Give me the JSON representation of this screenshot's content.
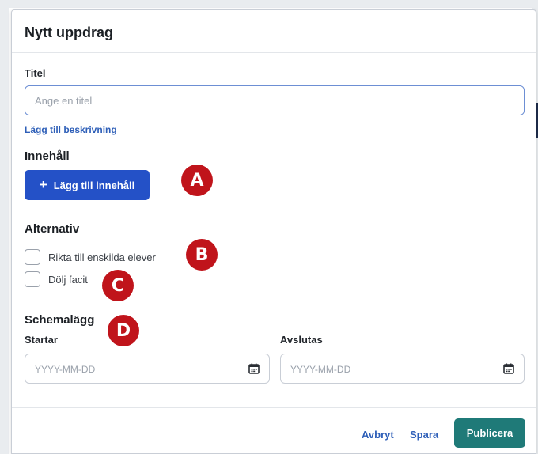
{
  "dialog": {
    "title": "Nytt uppdrag"
  },
  "form": {
    "title_label": "Titel",
    "title_placeholder": "Ange en titel",
    "add_description_link": "Lägg till beskrivning",
    "content_heading": "Innehåll",
    "add_content_button": "Lägg till innehåll",
    "options_heading": "Alternativ",
    "options": [
      {
        "label": "Rikta till enskilda elever",
        "checked": false
      },
      {
        "label": "Dölj facit",
        "checked": false
      }
    ],
    "schedule_heading": "Schemalägg",
    "start_label": "Startar",
    "start_placeholder": "YYYY-MM-DD",
    "end_label": "Avslutas",
    "end_placeholder": "YYYY-MM-DD"
  },
  "footer": {
    "cancel_label": "Avbryt",
    "save_label": "Spara",
    "publish_label": "Publicera"
  },
  "markers": [
    "A",
    "B",
    "C",
    "D"
  ],
  "colors": {
    "primary": "#2451c7",
    "publish": "#1f7a78",
    "link": "#2e5fb8",
    "marker": "#c0141b"
  },
  "icons": {
    "add": "plus-icon",
    "date": "calendar-icon"
  }
}
